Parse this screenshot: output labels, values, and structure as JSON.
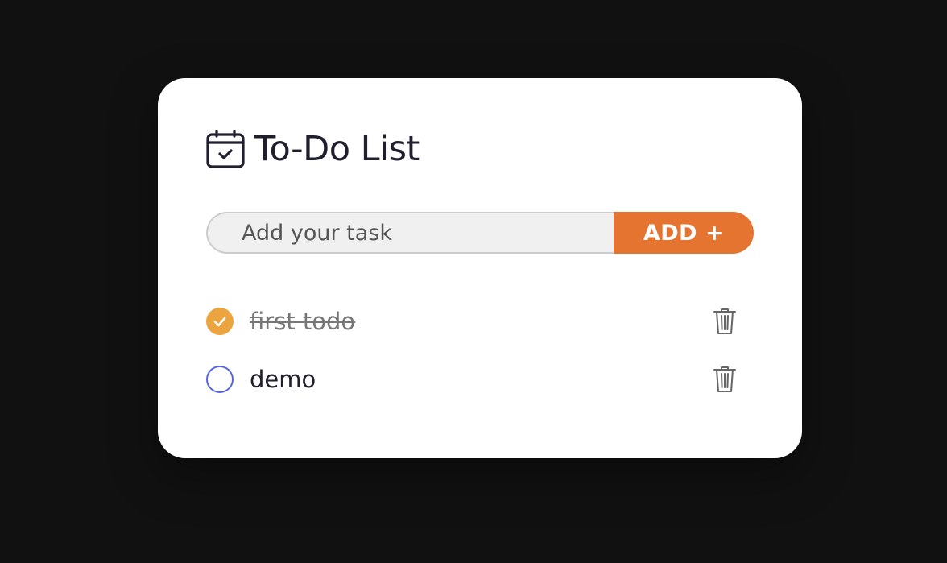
{
  "app": {
    "title": "To-Do List",
    "title_icon": "calendar-check-icon"
  },
  "input": {
    "placeholder": "Add your task",
    "value": ""
  },
  "add_button": {
    "label": "ADD +"
  },
  "todos": [
    {
      "text": "first todo",
      "completed": true
    },
    {
      "text": "demo",
      "completed": false
    }
  ],
  "colors": {
    "background": "#111111",
    "card": "#ffffff",
    "accent": "#e57430",
    "checked": "#eba43f",
    "unchecked_border": "#5566e0"
  }
}
